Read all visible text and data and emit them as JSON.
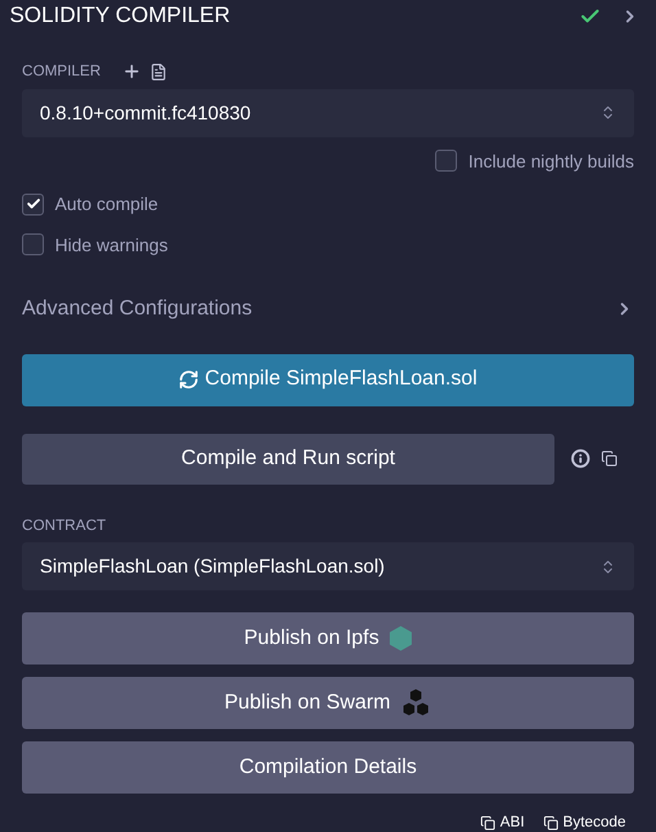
{
  "header": {
    "title": "SOLIDITY COMPILER",
    "compiled_ok": true
  },
  "compiler": {
    "label": "COMPILER",
    "version": "0.8.10+commit.fc410830"
  },
  "options": [
    {
      "label": "Include nightly builds",
      "checked": false
    },
    {
      "label": "Auto compile",
      "checked": true
    },
    {
      "label": "Hide warnings",
      "checked": false
    }
  ],
  "advanced": {
    "label": "Advanced Configurations",
    "expanded": false
  },
  "compile_button": "Compile SimpleFlashLoan.sol",
  "run_script_button": "Compile and Run script",
  "contract": {
    "label": "CONTRACT",
    "value": "SimpleFlashLoan (SimpleFlashLoan.sol)"
  },
  "actions": [
    {
      "label": "Publish on Ipfs",
      "kind": "ipfs"
    },
    {
      "label": "Publish on Swarm",
      "kind": "swarm"
    },
    {
      "label": "Compilation Details",
      "kind": "plain"
    }
  ],
  "copy_links": [
    "ABI",
    "Bytecode"
  ]
}
